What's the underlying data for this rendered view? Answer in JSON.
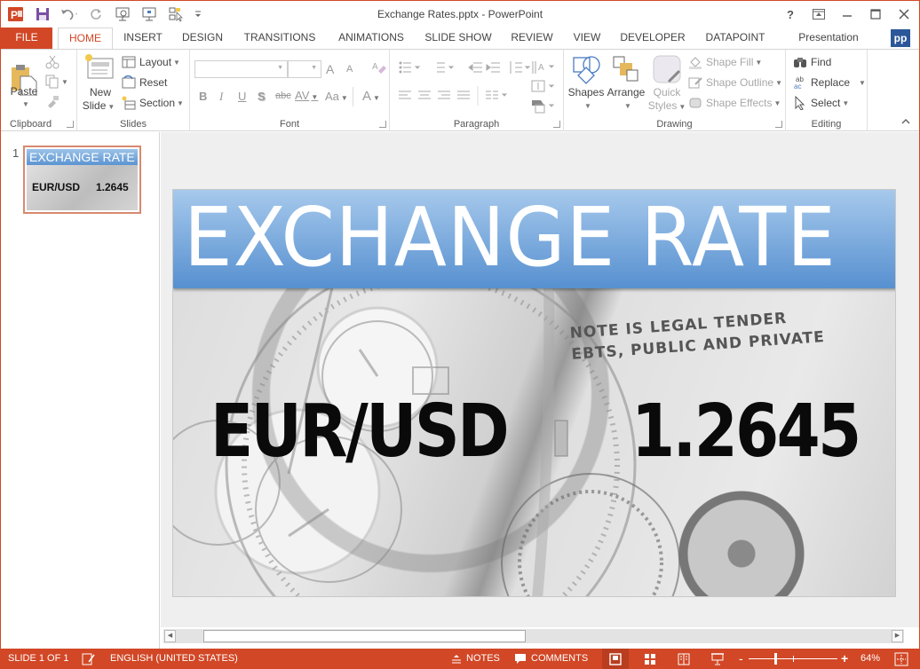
{
  "window": {
    "title": "Exchange Rates.pptx - PowerPoint",
    "controls": {
      "help": "?",
      "ribbon_display": "ribbon-display-options",
      "minimize": "minimize",
      "maximize": "maximize",
      "close": "close"
    }
  },
  "qat": [
    "powerpoint-logo",
    "save",
    "undo",
    "redo",
    "start-from-beginning",
    "present",
    "select-objects",
    "customize-qat"
  ],
  "tabs": [
    {
      "label": "FILE"
    },
    {
      "label": "HOME",
      "active": true
    },
    {
      "label": "INSERT"
    },
    {
      "label": "DESIGN"
    },
    {
      "label": "TRANSITIONS"
    },
    {
      "label": "ANIMATIONS"
    },
    {
      "label": "SLIDE SHOW"
    },
    {
      "label": "REVIEW"
    },
    {
      "label": "VIEW"
    },
    {
      "label": "DEVELOPER"
    },
    {
      "label": "DATAPOINT"
    },
    {
      "label": "Presentation Point"
    }
  ],
  "pp_badge": "pp",
  "ribbon": {
    "clipboard": {
      "label": "Clipboard",
      "paste": "Paste"
    },
    "slides": {
      "label": "Slides",
      "new_slide_1": "New",
      "new_slide_2": "Slide",
      "layout": "Layout",
      "reset": "Reset",
      "section": "Section"
    },
    "font": {
      "label": "Font",
      "font_name": "",
      "font_size": "",
      "bold": "B",
      "italic": "I",
      "underline": "U",
      "shadow": "S",
      "strike": "abc",
      "spacing": "AV",
      "case": "Aa",
      "color": "A",
      "grow": "A",
      "shrink": "A"
    },
    "paragraph": {
      "label": "Paragraph"
    },
    "drawing": {
      "label": "Drawing",
      "shapes": "Shapes",
      "arrange": "Arrange",
      "quick_styles_1": "Quick",
      "quick_styles_2": "Styles",
      "shape_fill": "Shape Fill",
      "shape_outline": "Shape Outline",
      "shape_effects": "Shape Effects"
    },
    "editing": {
      "label": "Editing",
      "find": "Find",
      "replace": "Replace",
      "select": "Select"
    }
  },
  "thumbnails": [
    {
      "number": "1",
      "title": "EXCHANGE RATE",
      "pair": "EUR/USD",
      "rate": "1.2645"
    }
  ],
  "slide": {
    "title": "EXCHANGE RATE",
    "pair": "EUR/USD",
    "rate": "1.2645",
    "background_text_1": "NOTE IS LEGAL TENDER",
    "background_text_2": "EBTS, PUBLIC AND PRIVATE"
  },
  "statusbar": {
    "slide_info": "SLIDE 1 OF 1",
    "language": "ENGLISH (UNITED STATES)",
    "notes": "NOTES",
    "comments": "COMMENTS",
    "zoom_minus": "-",
    "zoom_plus": "+",
    "zoom_level": "64%",
    "zoom_percent": 64
  },
  "colors": {
    "accent": "#d24726",
    "title_blue": "#5790d0",
    "pp_blue": "#2b579a"
  }
}
